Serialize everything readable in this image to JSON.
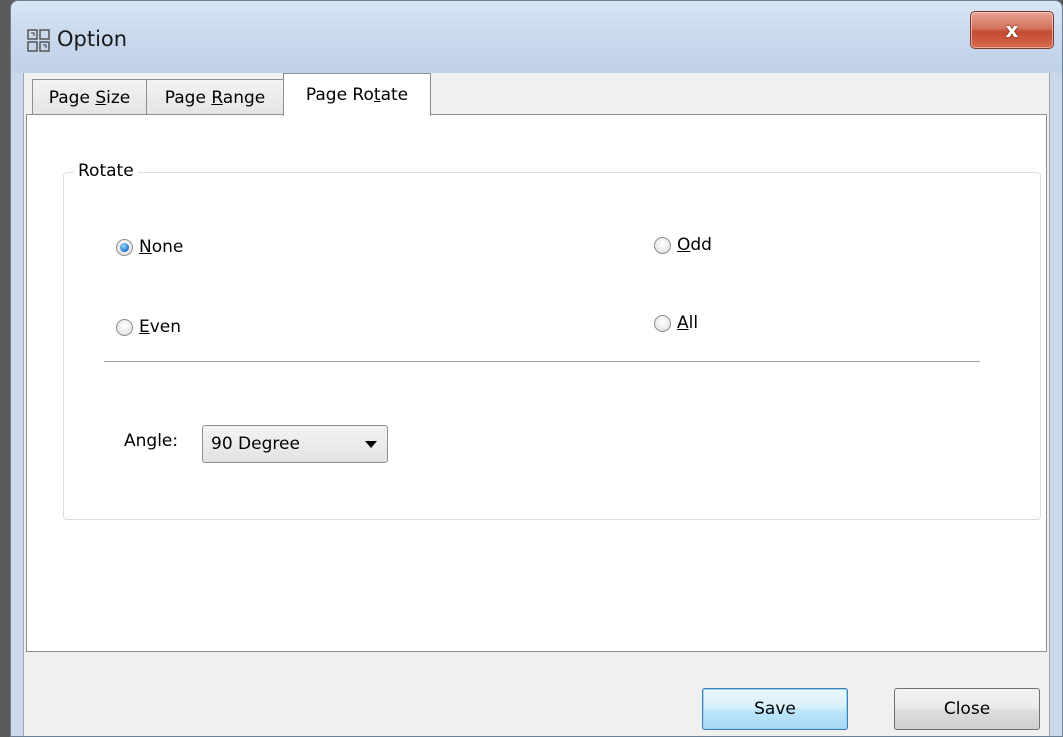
{
  "window": {
    "title": "Option",
    "close_glyph": "x"
  },
  "tabs": [
    {
      "label_pre": "Page ",
      "label_key": "S",
      "label_post": "ize",
      "active": false
    },
    {
      "label_pre": "Page ",
      "label_key": "R",
      "label_post": "ange",
      "active": false
    },
    {
      "label_pre": "Page Ro",
      "label_key": "t",
      "label_post": "ate",
      "active": true
    }
  ],
  "rotate_group": {
    "label": "Rotate",
    "options": [
      {
        "key": "N",
        "rest": "one",
        "checked": true
      },
      {
        "key": "O",
        "rest": "dd",
        "checked": false
      },
      {
        "key": "E",
        "rest": "ven",
        "checked": false
      },
      {
        "key": "A",
        "rest": "ll",
        "checked": false
      }
    ],
    "angle_label": "Angle:",
    "angle_value": "90 Degree"
  },
  "buttons": {
    "save_label": "Save",
    "close_label": "Close"
  },
  "icons": {
    "app": "option-app-icon",
    "close": "close-icon",
    "dropdown": "chevron-down-icon"
  }
}
